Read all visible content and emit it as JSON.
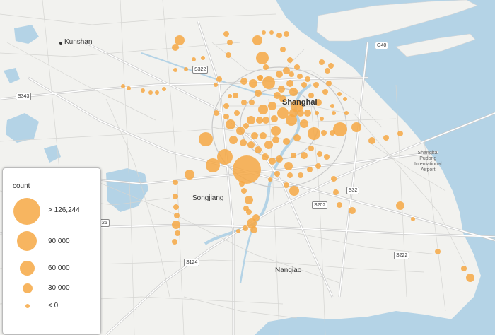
{
  "map": {
    "colors": {
      "water": "#b4d3e6",
      "land": "#f2f2ef",
      "road": "#ffffff",
      "road_casing": "#c9c9c9",
      "bubble": "#f6a844"
    },
    "places": {
      "kunshan": "Kunshan",
      "shanghai": "Shanghai",
      "songjiang": "Songjiang",
      "nanqiao": "Nanqiao",
      "airport": "Shanghai\nPudong\nInternational\nAirport"
    },
    "road_shields": {
      "g40": "G40",
      "s322": "S322",
      "s343": "S343",
      "s32": "S32",
      "s202": "S202",
      "s222": "S222",
      "s124": "S124",
      "g25_partial": "25"
    }
  },
  "legend": {
    "title": "count",
    "items": [
      {
        "label": "> 126,244",
        "value": 126244
      },
      {
        "label": "90,000",
        "value": 90000
      },
      {
        "label": "60,000",
        "value": 60000
      },
      {
        "label": "30,000",
        "value": 30000
      },
      {
        "label": "< 0",
        "value": 0
      }
    ]
  }
}
